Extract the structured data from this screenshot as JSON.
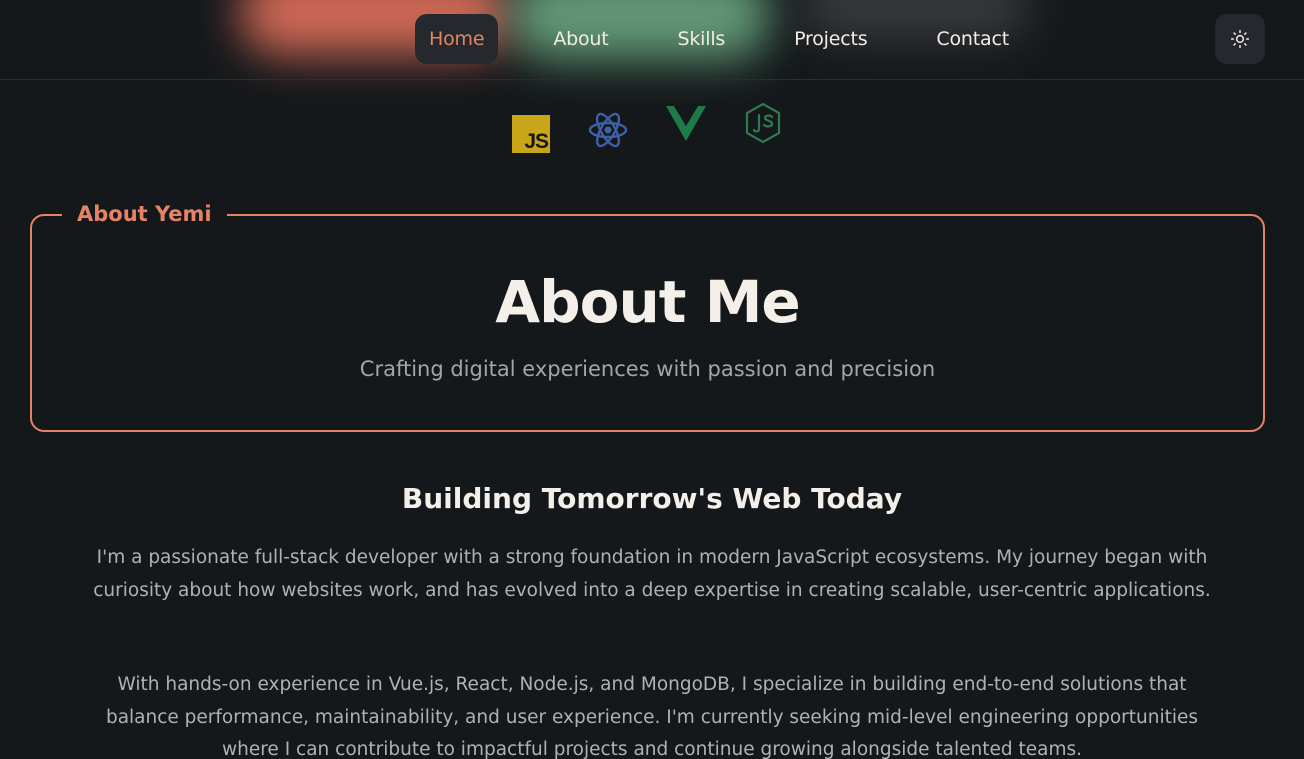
{
  "nav": {
    "items": [
      "Home",
      "About",
      "Skills",
      "Projects",
      "Contact"
    ],
    "active": "Home",
    "accent": "#e48366"
  },
  "theme_toggle": {
    "icon": "sun-icon"
  },
  "tech_icons": [
    {
      "name": "javascript-icon",
      "label": "JS",
      "color": "#c9a51a"
    },
    {
      "name": "react-icon",
      "color": "#3f5fa8"
    },
    {
      "name": "vue-icon",
      "color": "#1f7a4a"
    },
    {
      "name": "nodejs-icon",
      "color": "#2f7a4f"
    }
  ],
  "about": {
    "legend": "About Yemi",
    "title": "About Me",
    "subtitle": "Crafting digital experiences with passion and precision"
  },
  "story": {
    "heading": "Building Tomorrow's Web Today",
    "paragraphs": [
      "I'm a passionate full-stack developer with a strong foundation in modern JavaScript ecosystems. My journey began with curiosity about how websites work, and has evolved into a deep expertise in creating scalable, user-centric applications.",
      "With hands-on experience in Vue.js, React, Node.js, and MongoDB, I specialize in building end-to-end solutions that balance performance, maintainability, and user experience. I'm currently seeking mid-level engineering opportunities where I can contribute to impactful projects and continue growing alongside talented teams."
    ]
  },
  "colors": {
    "background": "#15181b",
    "accent": "#e48366",
    "text": "#f1ece6",
    "muted": "#b1b1b1"
  }
}
